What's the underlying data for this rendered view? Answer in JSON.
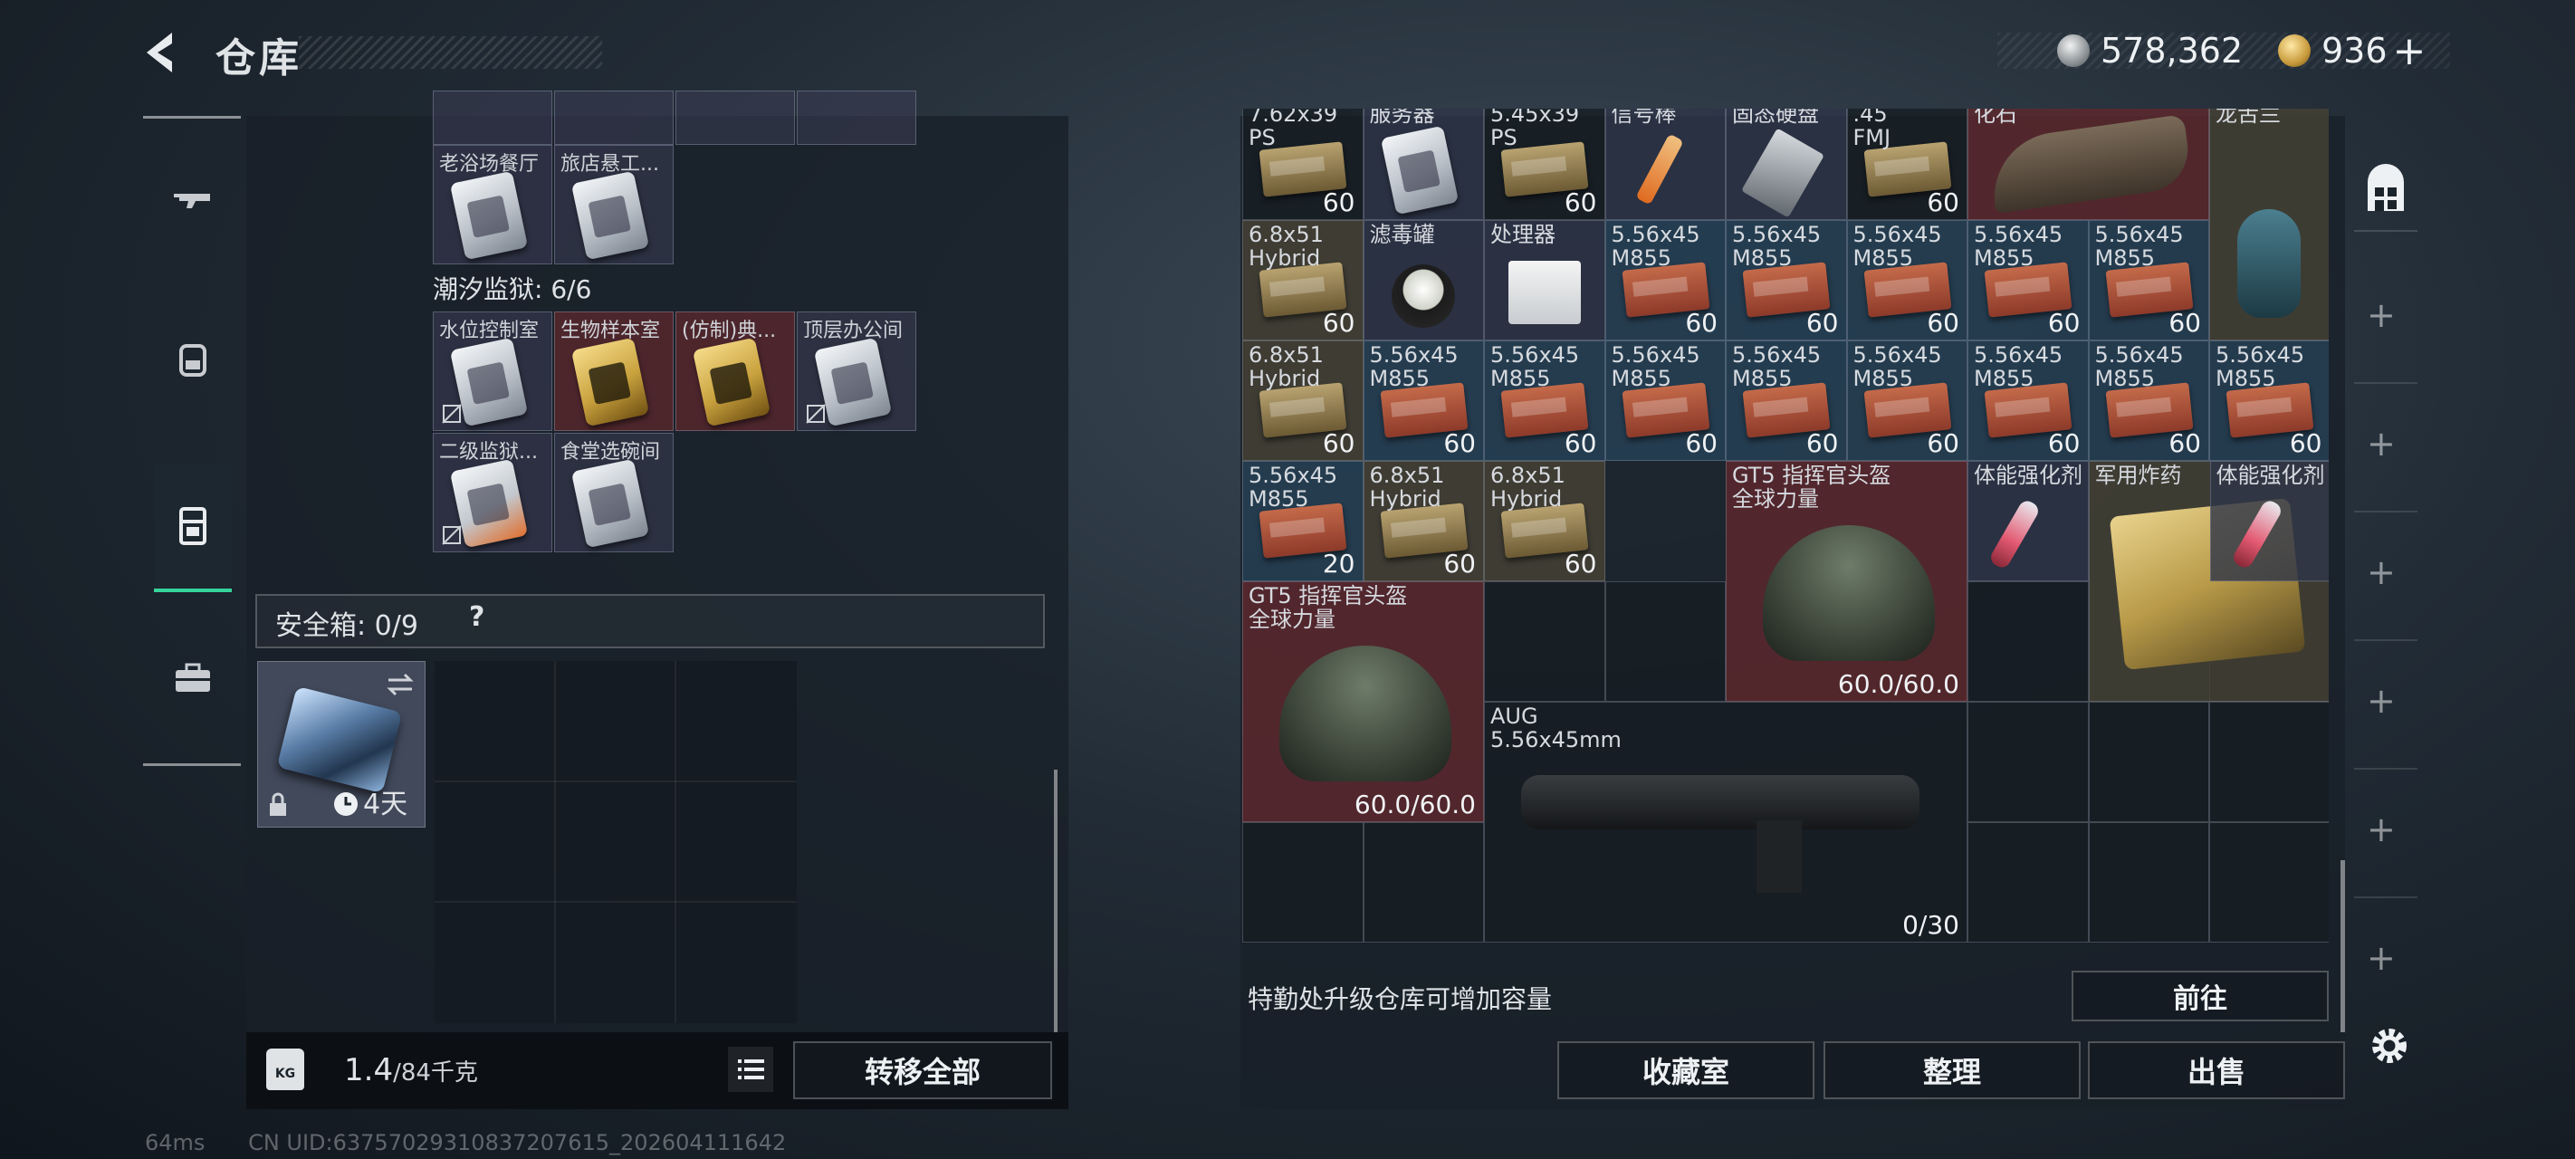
{
  "header": {
    "title": "仓库",
    "silver_amount": "578,362",
    "gold_amount": "936",
    "plus": "+"
  },
  "left_panel": {
    "top_items": [
      {
        "label": "老浴场餐厅",
        "style": "silver"
      },
      {
        "label": "旅店悬工...",
        "style": "silver"
      }
    ],
    "section_prison": "潮汐监狱: 6/6",
    "prison_items": [
      {
        "label": "水位控制室",
        "style": "silver",
        "red": false
      },
      {
        "label": "生物样本室",
        "style": "gold",
        "red": true
      },
      {
        "label": "(仿制)典...",
        "style": "gold",
        "red": true
      },
      {
        "label": "顶层办公间",
        "style": "silver",
        "red": false
      },
      {
        "label": "二级监狱...",
        "style": "silver",
        "red": false
      },
      {
        "label": "食堂选碗间",
        "style": "silver",
        "red": false
      }
    ],
    "safe_label": "安全箱: 0/9",
    "safe_help": "?",
    "safe_timer": "4天",
    "weight_value": "1.4",
    "weight_max": "/84千克",
    "kg_label": "KG",
    "transfer_all": "转移全部"
  },
  "warehouse": {
    "row1": [
      {
        "name": "7.62x39\nPS",
        "count": "60",
        "color": "dark",
        "icon": "ammo-tan"
      },
      {
        "name": "服务器",
        "count": "",
        "color": "navy",
        "icon": "card"
      },
      {
        "name": "5.45x39\nPS",
        "count": "60",
        "color": "dark",
        "icon": "ammo-tan"
      },
      {
        "name": "信号棒",
        "count": "",
        "color": "navy",
        "icon": "flare"
      },
      {
        "name": "固态硬盘",
        "count": "",
        "color": "navy",
        "icon": "ssd"
      },
      {
        "name": ".45\nFMJ",
        "count": "60",
        "color": "dark",
        "icon": "ammo-tan"
      },
      {
        "name": "化石",
        "count": "",
        "color": "red",
        "icon": "fossil"
      },
      {
        "name": "龙舌兰",
        "count": "",
        "color": "green",
        "icon": "bottle"
      }
    ],
    "row2": [
      {
        "name": "6.8x51\nHybrid",
        "count": "60",
        "color": "green",
        "icon": "ammo-tan"
      },
      {
        "name": "滤毒罐",
        "count": "",
        "color": "navy",
        "icon": "canister"
      },
      {
        "name": "处理器",
        "count": "",
        "color": "navy",
        "icon": "processor"
      },
      {
        "name": "5.56x45\nM855",
        "count": "60",
        "color": "blue",
        "icon": "ammo"
      },
      {
        "name": "5.56x45\nM855",
        "count": "60",
        "color": "blue",
        "icon": "ammo"
      },
      {
        "name": "5.56x45\nM855",
        "count": "60",
        "color": "blue",
        "icon": "ammo"
      },
      {
        "name": "5.56x45\nM855",
        "count": "60",
        "color": "blue",
        "icon": "ammo"
      },
      {
        "name": "5.56x45\nM855",
        "count": "60",
        "color": "blue",
        "icon": "ammo"
      }
    ],
    "row3": [
      {
        "name": "6.8x51\nHybrid",
        "count": "60",
        "color": "green",
        "icon": "ammo-tan"
      },
      {
        "name": "5.56x45\nM855",
        "count": "60",
        "color": "blue",
        "icon": "ammo"
      },
      {
        "name": "5.56x45\nM855",
        "count": "60",
        "color": "blue",
        "icon": "ammo"
      },
      {
        "name": "5.56x45\nM855",
        "count": "60",
        "color": "blue",
        "icon": "ammo"
      },
      {
        "name": "5.56x45\nM855",
        "count": "60",
        "color": "blue",
        "icon": "ammo"
      },
      {
        "name": "5.56x45\nM855",
        "count": "60",
        "color": "blue",
        "icon": "ammo"
      },
      {
        "name": "5.56x45\nM855",
        "count": "60",
        "color": "blue",
        "icon": "ammo"
      },
      {
        "name": "5.56x45\nM855",
        "count": "60",
        "color": "blue",
        "icon": "ammo"
      },
      {
        "name": "5.56x45\nM855",
        "count": "60",
        "color": "blue",
        "icon": "ammo"
      }
    ],
    "row4_small": [
      {
        "name": "5.56x45\nM855",
        "count": "20",
        "color": "blue",
        "icon": "ammo"
      },
      {
        "name": "6.8x51\nHybrid",
        "count": "60",
        "color": "green",
        "icon": "ammo-tan"
      },
      {
        "name": "6.8x51\nHybrid",
        "count": "60",
        "color": "green",
        "icon": "ammo-tan"
      }
    ],
    "helmet1": {
      "name": "GT5 指挥官头盔\n全球力量",
      "durability": "60.0/60.0"
    },
    "stim1": {
      "name": "体能强化剂"
    },
    "explosive": {
      "name": "军用炸药"
    },
    "stim2": {
      "name": "体能强化剂"
    },
    "helmet2": {
      "name": "GT5 指挥官头盔\n全球力量",
      "durability": "60.0/60.0"
    },
    "gun": {
      "name": "AUG\n5.56x45mm",
      "ammo": "0/30"
    },
    "upgrade_hint": "特勤处升级仓库可增加容量",
    "goto_button": "前往",
    "collection_button": "收藏室",
    "sort_button": "整理",
    "sell_button": "出售"
  },
  "status": {
    "ping": "64ms",
    "uid": "CN UID:637570293108372076​15_202604111642"
  },
  "colors": {
    "accent": "#35d39b",
    "blue_cell": "#28465c",
    "red_cell": "#5f282d",
    "green_cell": "#464234"
  }
}
